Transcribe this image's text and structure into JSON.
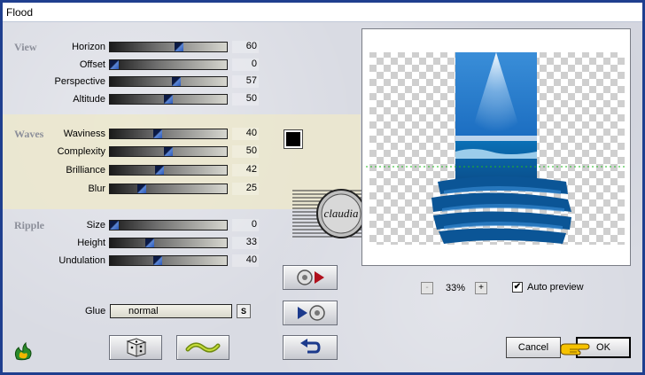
{
  "window": {
    "title": "Flood"
  },
  "sections": {
    "view": "View",
    "waves": "Waves",
    "ripple": "Ripple"
  },
  "controls": {
    "horizon": {
      "label": "Horizon",
      "value": "60",
      "level": 0.6
    },
    "offset": {
      "label": "Offset",
      "value": "0",
      "level": 0.0
    },
    "perspective": {
      "label": "Perspective",
      "value": "57",
      "level": 0.57
    },
    "altitude": {
      "label": "Altitude",
      "value": "50",
      "level": 0.5
    },
    "waviness": {
      "label": "Waviness",
      "value": "40",
      "level": 0.4
    },
    "complexity": {
      "label": "Complexity",
      "value": "50",
      "level": 0.5
    },
    "brilliance": {
      "label": "Brilliance",
      "value": "42",
      "level": 0.42
    },
    "blur": {
      "label": "Blur",
      "value": "25",
      "level": 0.25
    },
    "size": {
      "label": "Size",
      "value": "0",
      "level": 0.0
    },
    "height": {
      "label": "Height",
      "value": "33",
      "level": 0.33
    },
    "undulation": {
      "label": "Undulation",
      "value": "40",
      "level": 0.4
    }
  },
  "color": "#000000",
  "watermark": {
    "text": "claudia"
  },
  "glue": {
    "label": "Glue",
    "value": "normal",
    "button": "S"
  },
  "zoom": {
    "minus": "-",
    "plus": "+",
    "value": "33%"
  },
  "auto_preview": {
    "label": "Auto preview",
    "checked": true
  },
  "buttons": {
    "cancel": "Cancel",
    "ok": "OK"
  }
}
